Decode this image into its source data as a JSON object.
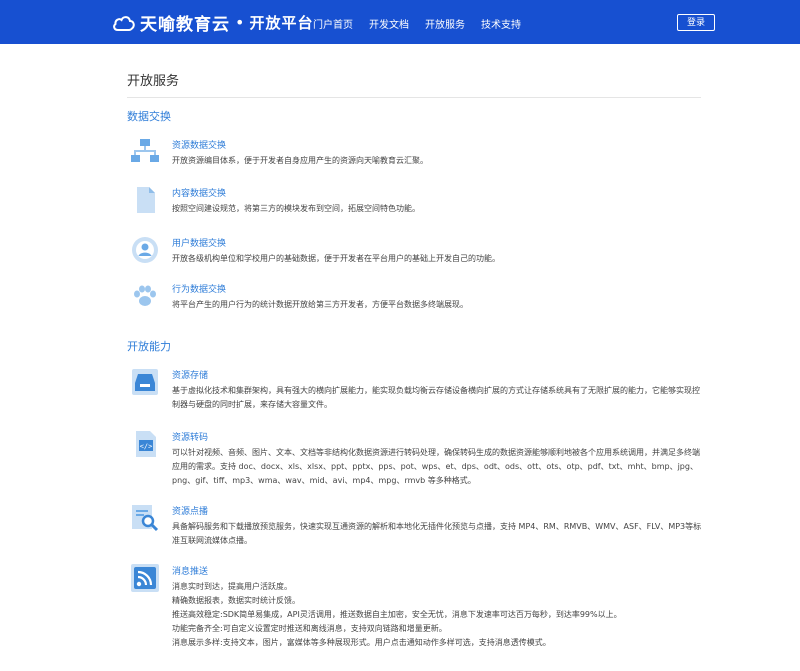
{
  "header": {
    "brand": "天喻教育云",
    "dot": "•",
    "subtitle": "开放平台",
    "nav": [
      "门户首页",
      "开发文档",
      "开放服务",
      "技术支持"
    ],
    "login": "登录"
  },
  "page_title": "开放服务",
  "data_exchange": {
    "title": "数据交换",
    "items": [
      {
        "icon": "network-icon",
        "name": "资源数据交换",
        "desc": "开放资源编目体系，便于开发者自身应用产生的资源向天喻教育云汇聚。"
      },
      {
        "icon": "document-icon",
        "name": "内容数据交换",
        "desc": "按照空间建设规范，将第三方的模块发布到空间，拓展空间特色功能。"
      },
      {
        "icon": "user-circle-icon",
        "name": "用户数据交换",
        "desc": "开放各级机构单位和学校用户的基础数据，便于开发者在平台用户的基础上开发自己的功能。"
      },
      {
        "icon": "paw-icon",
        "name": "行为数据交换",
        "desc": "将平台产生的用户行为的统计数据开放给第三方开发者，方便平台数据多终端展现。"
      }
    ]
  },
  "capabilities": {
    "title": "开放能力",
    "items": [
      {
        "icon": "storage-icon",
        "name": "资源存储",
        "desc": "基于虚拟化技术和集群架构，具有强大的横向扩展能力，能实现负载均衡云存储设备横向扩展的方式让存储系统具有了无限扩展的能力，它能够实现控制器与硬盘的同时扩展，来存储大容量文件。"
      },
      {
        "icon": "code-icon",
        "name": "资源转码",
        "desc": "可以针对视频、音频、图片、文本、文档等非结构化数据资源进行转码处理，确保转码生成的数据资源能够顺利地被各个应用系统调用，并满足多终端应用的需求。支持 doc、docx、xls、xlsx、ppt、pptx、pps、pot、wps、et、dps、odt、ods、ott、ots、otp、pdf、txt、mht、bmp、jpg、png、gif、tiff、mp3、wma、wav、mid、avi、mp4、mpg、rmvb 等多种格式。"
      },
      {
        "icon": "search-doc-icon",
        "name": "资源点播",
        "desc": "具备解码服务和下载播放预览服务，快速实现互通资源的解析和本地化无插件化预览与点播，支持 MP4、RM、RMVB、WMV、ASF、FLV、MP3等标准互联网流媒体点播。"
      },
      {
        "icon": "rss-icon",
        "name": "消息推送",
        "desc": "消息实时到达，提高用户活跃度。\n精确数据报表，数据实时统计反馈。\n推送高效稳定:SDK简单易集成，API灵活调用，推送数据自主加密，安全无忧，消息下发速率可达百万每秒，到达率99%以上。\n功能完备齐全:可自定义设置定时推送和离线消息，支持双向链路和增量更新。\n消息展示多样:支持文本，图片，富媒体等多种展现形式。用户点击通知动作多样可选，支持消息透传模式。"
      }
    ]
  },
  "colors": {
    "header_bg": "#1750d1",
    "accent": "#2f7dd8",
    "icon_light": "#c9dff5",
    "icon_mid": "#6aa9e6",
    "icon_dark": "#3a86d6"
  }
}
